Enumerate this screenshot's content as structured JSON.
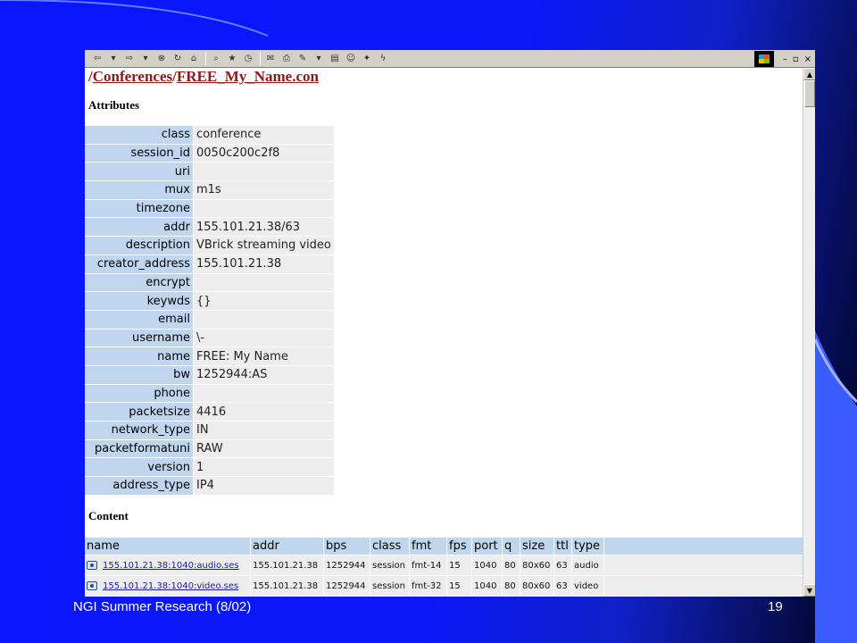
{
  "colors": {
    "slide_blue": "#0b18f8",
    "accent_blue": "#3a5cff",
    "key_cell": "#bfd6ee",
    "value_cell": "#ededed",
    "link_maroon": "#8b1a1a",
    "link_blue": "#1a1aa8"
  },
  "toolbar": {
    "icons": [
      "back-icon",
      "forward-icon",
      "stop-icon",
      "refresh-icon",
      "home-icon",
      "search-icon",
      "favorites-icon",
      "history-icon",
      "mail-icon",
      "print-icon",
      "edit-icon",
      "discuss-icon",
      "messenger-icon",
      "media-icon"
    ]
  },
  "path": {
    "segment1": "Conferences",
    "segment2": "FREE_My_Name.con"
  },
  "attributes": {
    "title": "Attributes",
    "rows": [
      {
        "key": "class",
        "value": "conference"
      },
      {
        "key": "session_id",
        "value": "0050c200c2f8"
      },
      {
        "key": "uri",
        "value": ""
      },
      {
        "key": "mux",
        "value": "m1s"
      },
      {
        "key": "timezone",
        "value": ""
      },
      {
        "key": "addr",
        "value": "155.101.21.38/63"
      },
      {
        "key": "description",
        "value": "VBrick streaming video"
      },
      {
        "key": "creator_address",
        "value": "155.101.21.38"
      },
      {
        "key": "encrypt",
        "value": ""
      },
      {
        "key": "keywds",
        "value": "{}"
      },
      {
        "key": "email",
        "value": ""
      },
      {
        "key": "username",
        "value": "\\-"
      },
      {
        "key": "name",
        "value": "FREE: My Name"
      },
      {
        "key": "bw",
        "value": "1252944:AS"
      },
      {
        "key": "phone",
        "value": ""
      },
      {
        "key": "packetsize",
        "value": "4416"
      },
      {
        "key": "network_type",
        "value": "IN"
      },
      {
        "key": "packetformatuni",
        "value": "RAW"
      },
      {
        "key": "version",
        "value": "1"
      },
      {
        "key": "address_type",
        "value": "IP4"
      }
    ]
  },
  "content": {
    "title": "Content",
    "columns": [
      "name",
      "addr",
      "bps",
      "class",
      "fmt",
      "fps",
      "port",
      "q",
      "size",
      "ttl",
      "type"
    ],
    "rows": [
      {
        "name": "155.101.21.38:1040:audio.ses",
        "addr": "155.101.21.38",
        "bps": "1252944",
        "class": "session",
        "fmt": "fmt-14",
        "fps": "15",
        "port": "1040",
        "q": "80",
        "size": "80x60",
        "ttl": "63",
        "type": "audio"
      },
      {
        "name": "155.101.21.38:1040:video.ses",
        "addr": "155.101.21.38",
        "bps": "1252944",
        "class": "session",
        "fmt": "fmt-32",
        "fps": "15",
        "port": "1040",
        "q": "80",
        "size": "80x60",
        "ttl": "63",
        "type": "video"
      }
    ]
  },
  "footer": {
    "left": "NGI Summer Research (8/02)",
    "page": "19"
  }
}
